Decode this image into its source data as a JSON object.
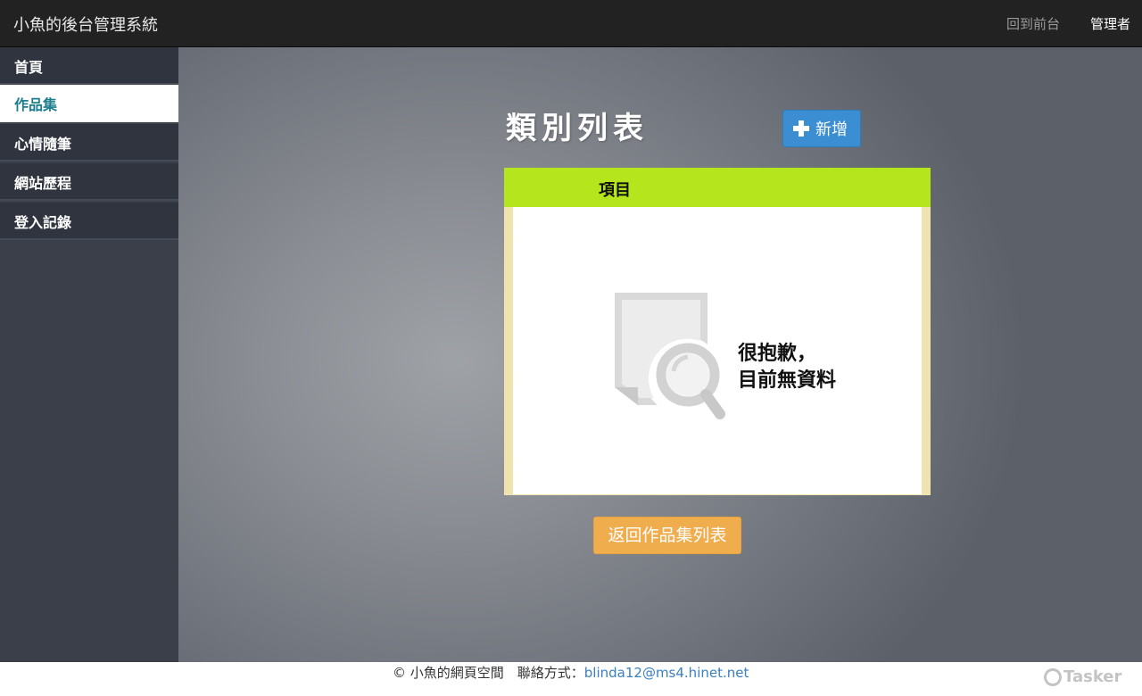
{
  "header": {
    "brand": "小魚的後台管理系統",
    "nav_front": "回到前台",
    "nav_admin": "管理者"
  },
  "sidebar": {
    "items": [
      {
        "label": "首頁"
      },
      {
        "label": "作品集",
        "active": true
      },
      {
        "label": "心情隨筆"
      },
      {
        "label": "網站歷程"
      },
      {
        "label": "登入記錄"
      }
    ]
  },
  "main": {
    "title": "類別列表",
    "add_label": "新增",
    "table": {
      "column_header": "項目",
      "empty_line1": "很抱歉，",
      "empty_line2": "目前無資料"
    },
    "back_label": "返回作品集列表"
  },
  "footer": {
    "copyright": "© 小魚的網頁空間　聯絡方式：",
    "email": "blinda12@ms4.hinet.net",
    "watermark": "Tasker"
  },
  "colors": {
    "header_bg": "#222222",
    "sidebar_bg": "#3a3f4a",
    "active_text": "#1d7e8f",
    "table_header": "#b5e61d",
    "add_button": "#3b8ed1",
    "back_button": "#f0ad4e"
  },
  "icons": {
    "add": "plus-icon",
    "empty": "document-search-icon",
    "watermark": "tasker-logo-icon"
  }
}
